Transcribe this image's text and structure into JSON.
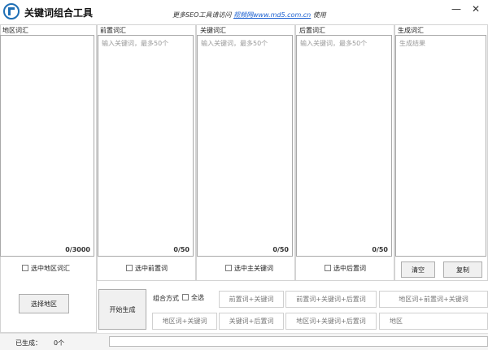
{
  "window": {
    "title": "关键词组合工具",
    "promo_prefix": "更多SEO工具请访问",
    "promo_link": "视频网www.md5.com.cn",
    "promo_suffix": "使用",
    "minimize": "—",
    "close": "✕"
  },
  "panels": [
    {
      "label": "地区词汇",
      "placeholder": "",
      "counter": "0/3000"
    },
    {
      "label": "前置词汇",
      "placeholder": "输入关键词，最多50个",
      "counter": "0/50"
    },
    {
      "label": "关键词汇",
      "placeholder": "输入关键词，最多50个",
      "counter": "0/50"
    },
    {
      "label": "后置词汇",
      "placeholder": "输入关键词，最多50个",
      "counter": "0/50"
    },
    {
      "label": "生成词汇",
      "placeholder": "生成结果",
      "counter": ""
    }
  ],
  "checkboxes": [
    {
      "label": "选中地区词汇"
    },
    {
      "label": "选中前置词"
    },
    {
      "label": "选中主关键词"
    },
    {
      "label": "选中后置词"
    }
  ],
  "buttons": {
    "clear": "清空",
    "copy": "复制",
    "select_region": "选择地区",
    "start": "开始生成"
  },
  "combo": {
    "label": "组合方式",
    "select_all": "全选",
    "row1": [
      "前置词+关键词",
      "前置词+关键词+后置词",
      "地区词+前置词+关键词"
    ],
    "row2": [
      "地区词+关键词",
      "关键词+后置词",
      "地区词+关键词+后置词",
      "地区"
    ]
  },
  "status": {
    "label": "已生成：",
    "count": "0个"
  }
}
